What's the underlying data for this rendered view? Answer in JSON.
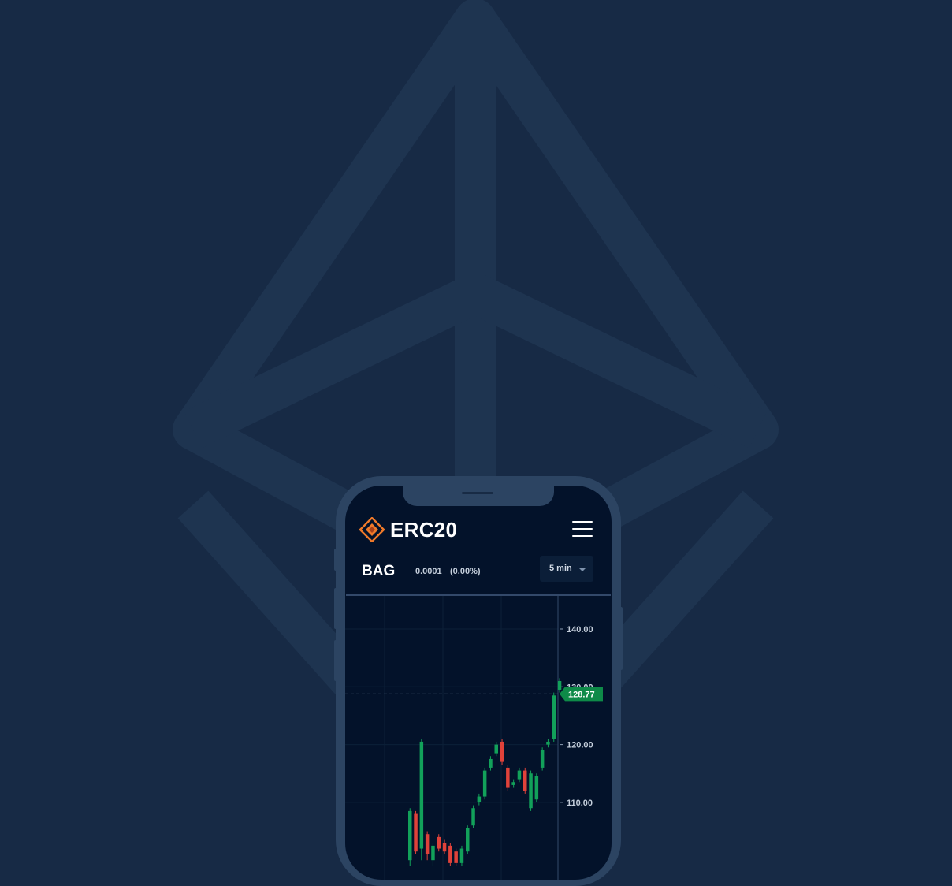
{
  "app": {
    "brand": "ERC20",
    "brand_logo_icon": "orange-diamond-logo",
    "menu_icon": "hamburger-menu-icon"
  },
  "ticker": {
    "symbol": "BAG",
    "change": "0.0001",
    "change_percent": "(0.00%)",
    "interval": "5 min"
  },
  "colors": {
    "background": "#172a45",
    "background_logo": "#1e3450",
    "phone_frame": "#2c4462",
    "screen": "#03122a",
    "accent": "#f07a2a",
    "up": "#12a15a",
    "down": "#e0423a",
    "price_tag": "#0e8a48"
  },
  "chart_data": {
    "type": "candlestick",
    "y_ticks": [
      "140.00",
      "130.00",
      "120.00",
      "110.00"
    ],
    "y_tick_values": [
      140,
      130,
      120,
      110
    ],
    "current_price": 128.77,
    "current_price_label": "128.77",
    "grid": true,
    "candles": [
      {
        "open": 100,
        "high": 109,
        "low": 99,
        "close": 108.5
      },
      {
        "open": 108,
        "high": 108.5,
        "low": 101,
        "close": 101.5
      },
      {
        "open": 102,
        "high": 121,
        "low": 100,
        "close": 120.5
      },
      {
        "open": 104.5,
        "high": 105,
        "low": 100,
        "close": 101
      },
      {
        "open": 100,
        "high": 103,
        "low": 99,
        "close": 102.5
      },
      {
        "open": 104,
        "high": 104.5,
        "low": 101.5,
        "close": 102
      },
      {
        "open": 103,
        "high": 103.5,
        "low": 101,
        "close": 101.5
      },
      {
        "open": 102.5,
        "high": 103,
        "low": 99,
        "close": 99.5
      },
      {
        "open": 101.5,
        "high": 102,
        "low": 99,
        "close": 99.5
      },
      {
        "open": 99.5,
        "high": 102.5,
        "low": 99,
        "close": 102
      },
      {
        "open": 101.5,
        "high": 106,
        "low": 101,
        "close": 105.5
      },
      {
        "open": 106,
        "high": 109.5,
        "low": 105.5,
        "close": 109
      },
      {
        "open": 110,
        "high": 111.5,
        "low": 109.5,
        "close": 111
      },
      {
        "open": 111,
        "high": 116,
        "low": 110.5,
        "close": 115.5
      },
      {
        "open": 116,
        "high": 118,
        "low": 115.5,
        "close": 117.5
      },
      {
        "open": 118.5,
        "high": 120.5,
        "low": 118,
        "close": 120
      },
      {
        "open": 120.5,
        "high": 121,
        "low": 116.5,
        "close": 117
      },
      {
        "open": 116,
        "high": 116.5,
        "low": 112,
        "close": 112.5
      },
      {
        "open": 113,
        "high": 114,
        "low": 112.5,
        "close": 113.5
      },
      {
        "open": 114,
        "high": 116,
        "low": 113.5,
        "close": 115.5
      },
      {
        "open": 115.5,
        "high": 116,
        "low": 111.5,
        "close": 112
      },
      {
        "open": 109,
        "high": 115.5,
        "low": 108.5,
        "close": 115
      },
      {
        "open": 110.5,
        "high": 115,
        "low": 110,
        "close": 114.5
      },
      {
        "open": 116,
        "high": 119.5,
        "low": 115.5,
        "close": 119
      },
      {
        "open": 120,
        "high": 121,
        "low": 119.5,
        "close": 120.5
      },
      {
        "open": 121,
        "high": 129,
        "low": 120.5,
        "close": 128.5
      },
      {
        "open": 129.5,
        "high": 131.5,
        "low": 129,
        "close": 131
      }
    ]
  }
}
